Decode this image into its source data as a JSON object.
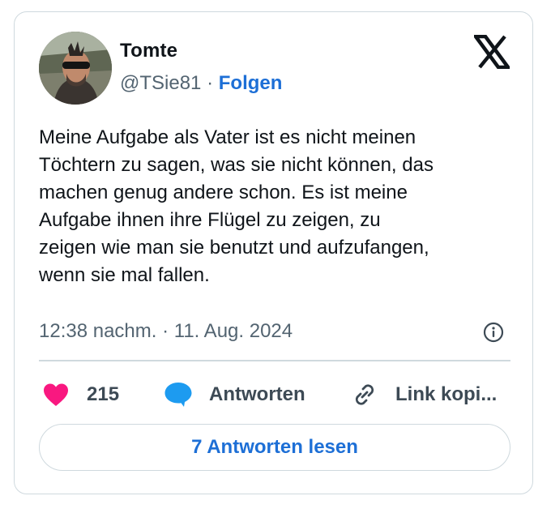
{
  "author": {
    "name": "Tomte",
    "handle": "@TSie81",
    "separator": "·",
    "follow_label": "Folgen"
  },
  "tweet": {
    "lines": [
      "Meine Aufgabe als Vater ist es nicht meinen",
      "Töchtern zu sagen, was sie nicht können, das",
      "machen genug andere schon. Es ist meine",
      "Aufgabe ihnen ihre Flügel zu zeigen, zu",
      "zeigen wie man sie benutzt und aufzufangen,",
      "wenn sie mal fallen."
    ],
    "timestamp": "12:38 nachm. · 11. Aug. 2024"
  },
  "actions": {
    "like_count": "215",
    "reply_label": "Antworten",
    "copy_link_label": "Link kopi..."
  },
  "read_replies_label": "7 Antworten lesen",
  "colors": {
    "like": "#f91880",
    "reply_bubble": "#1d9bf0",
    "link": "#1d6fd6",
    "muted": "#536471",
    "border": "#cfd9de"
  },
  "icons": {
    "brand": "x-logo-icon",
    "info": "info-icon",
    "like": "heart-icon",
    "reply": "speech-bubble-icon",
    "copy_link": "link-icon"
  }
}
